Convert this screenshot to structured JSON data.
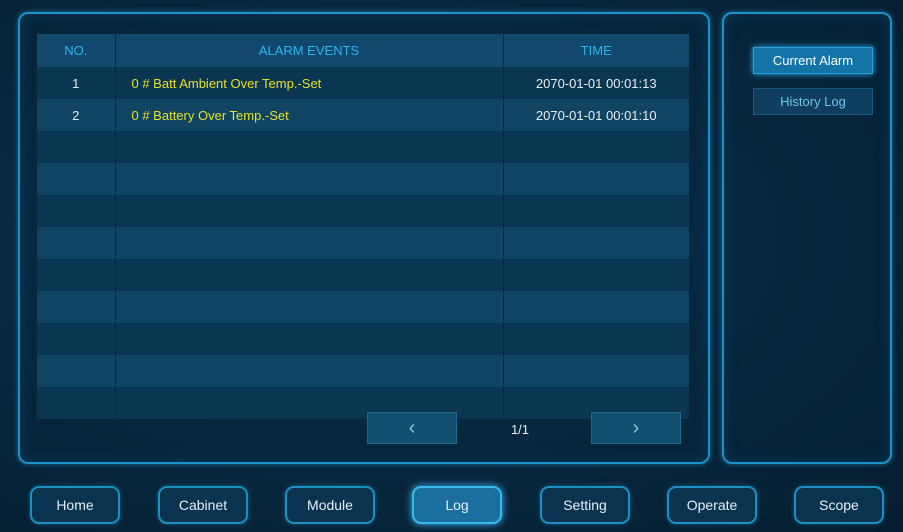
{
  "table": {
    "headers": {
      "no": "NO.",
      "events": "ALARM EVENTS",
      "time": "TIME"
    },
    "rows": [
      {
        "no": "1",
        "event": "0 # Batt Ambient Over Temp.-Set",
        "time": "2070-01-01  00:01:13"
      },
      {
        "no": "2",
        "event": "0 # Battery Over Temp.-Set",
        "time": "2070-01-01  00:01:10"
      }
    ]
  },
  "pager": {
    "prev_icon": "chevron-left-icon",
    "next_icon": "chevron-right-icon",
    "page": "1/1"
  },
  "side": {
    "current_alarm": "Current Alarm",
    "history_log": "History Log"
  },
  "nav": {
    "home": "Home",
    "cabinet": "Cabinet",
    "module": "Module",
    "log": "Log",
    "setting": "Setting",
    "operate": "Operate",
    "scope": "Scope",
    "active": "Log"
  },
  "colors": {
    "accent": "#1a93cc",
    "event_text": "#e6e02a",
    "header_text": "#2fb4f0"
  }
}
